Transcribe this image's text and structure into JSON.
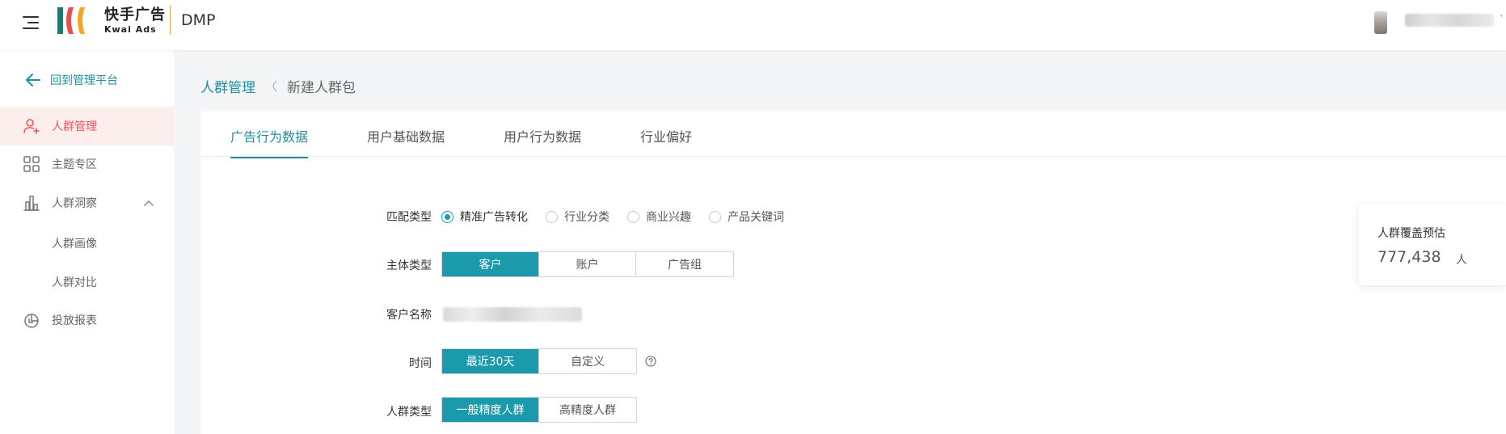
{
  "header": {
    "logo_cn": "快手广告",
    "logo_en": "Kwai Ads",
    "product": "DMP",
    "user_caret": "˅"
  },
  "sidebar": {
    "back_label": "回到管理平台",
    "items": [
      {
        "label": "人群管理",
        "icon": "user-add-icon",
        "active": true
      },
      {
        "label": "主题专区",
        "icon": "grid-icon"
      },
      {
        "label": "人群洞察",
        "icon": "bar-chart-icon",
        "expanded": true
      },
      {
        "label": "人群画像"
      },
      {
        "label": "人群对比"
      },
      {
        "label": "投放报表",
        "icon": "pie-report-icon"
      }
    ]
  },
  "breadcrumb": {
    "root": "人群管理",
    "separator": "〈",
    "current": "新建人群包"
  },
  "tabs": [
    {
      "label": "广告行为数据",
      "active": true
    },
    {
      "label": "用户基础数据"
    },
    {
      "label": "用户行为数据"
    },
    {
      "label": "行业偏好"
    }
  ],
  "form": {
    "match_type": {
      "label": "匹配类型",
      "options": [
        "精准广告转化",
        "行业分类",
        "商业兴趣",
        "产品关键词"
      ],
      "selected": "精准广告转化"
    },
    "entity_type": {
      "label": "主体类型",
      "options": [
        "客户",
        "账户",
        "广告组"
      ],
      "selected": "客户"
    },
    "client_name": {
      "label": "客户名称"
    },
    "time": {
      "label": "时间",
      "options": [
        "最近30天",
        "自定义"
      ],
      "selected": "最近30天"
    },
    "crowd_type": {
      "label": "人群类型",
      "options": [
        "一般精度人群",
        "高精度人群"
      ],
      "selected": "一般精度人群"
    }
  },
  "estimate": {
    "title": "人群覆盖预估",
    "value": "777,438",
    "unit": "人"
  },
  "colors": {
    "accent": "#1a9aaa",
    "link": "#1f8ea1",
    "active_nav_bg": "#fdeeee",
    "active_nav_text": "#f0545b",
    "logo_divider": "#f0a035"
  }
}
